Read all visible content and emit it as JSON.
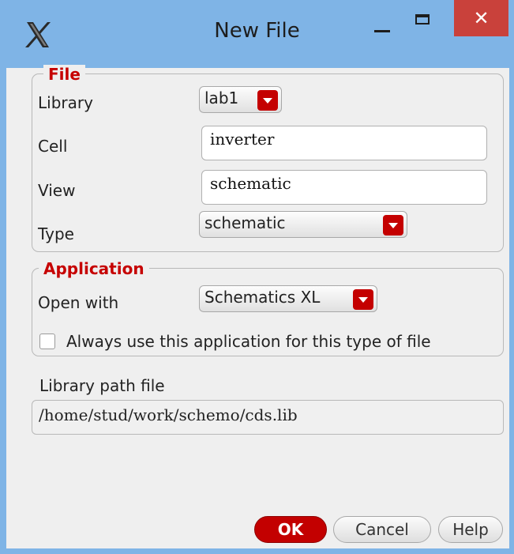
{
  "window": {
    "title": "New File",
    "close_glyph": "✕"
  },
  "file_group": {
    "legend": "File",
    "library_label": "Library",
    "library_value": "lab1",
    "cell_label": "Cell",
    "cell_value": "inverter",
    "view_label": "View",
    "view_value": "schematic",
    "type_label": "Type",
    "type_value": "schematic"
  },
  "application_group": {
    "legend": "Application",
    "open_with_label": "Open with",
    "open_with_value": "Schematics XL",
    "always_use_label": "Always use this application for this type of file",
    "always_use_checked": false
  },
  "library_path": {
    "label": "Library path file",
    "value": "/home/stud/work/schemo/cds.lib"
  },
  "buttons": {
    "ok": "OK",
    "cancel": "Cancel",
    "help": "Help"
  },
  "colors": {
    "titlebar": "#7fb4e6",
    "close_button": "#c9413b",
    "accent_red": "#c30000",
    "dialog_background": "#efefef"
  },
  "icons": {
    "app": "cadence-x-icon",
    "minimize": "minimize-icon",
    "maximize": "maximize-icon",
    "close": "close-icon",
    "dropdown": "chevron-down-icon"
  }
}
